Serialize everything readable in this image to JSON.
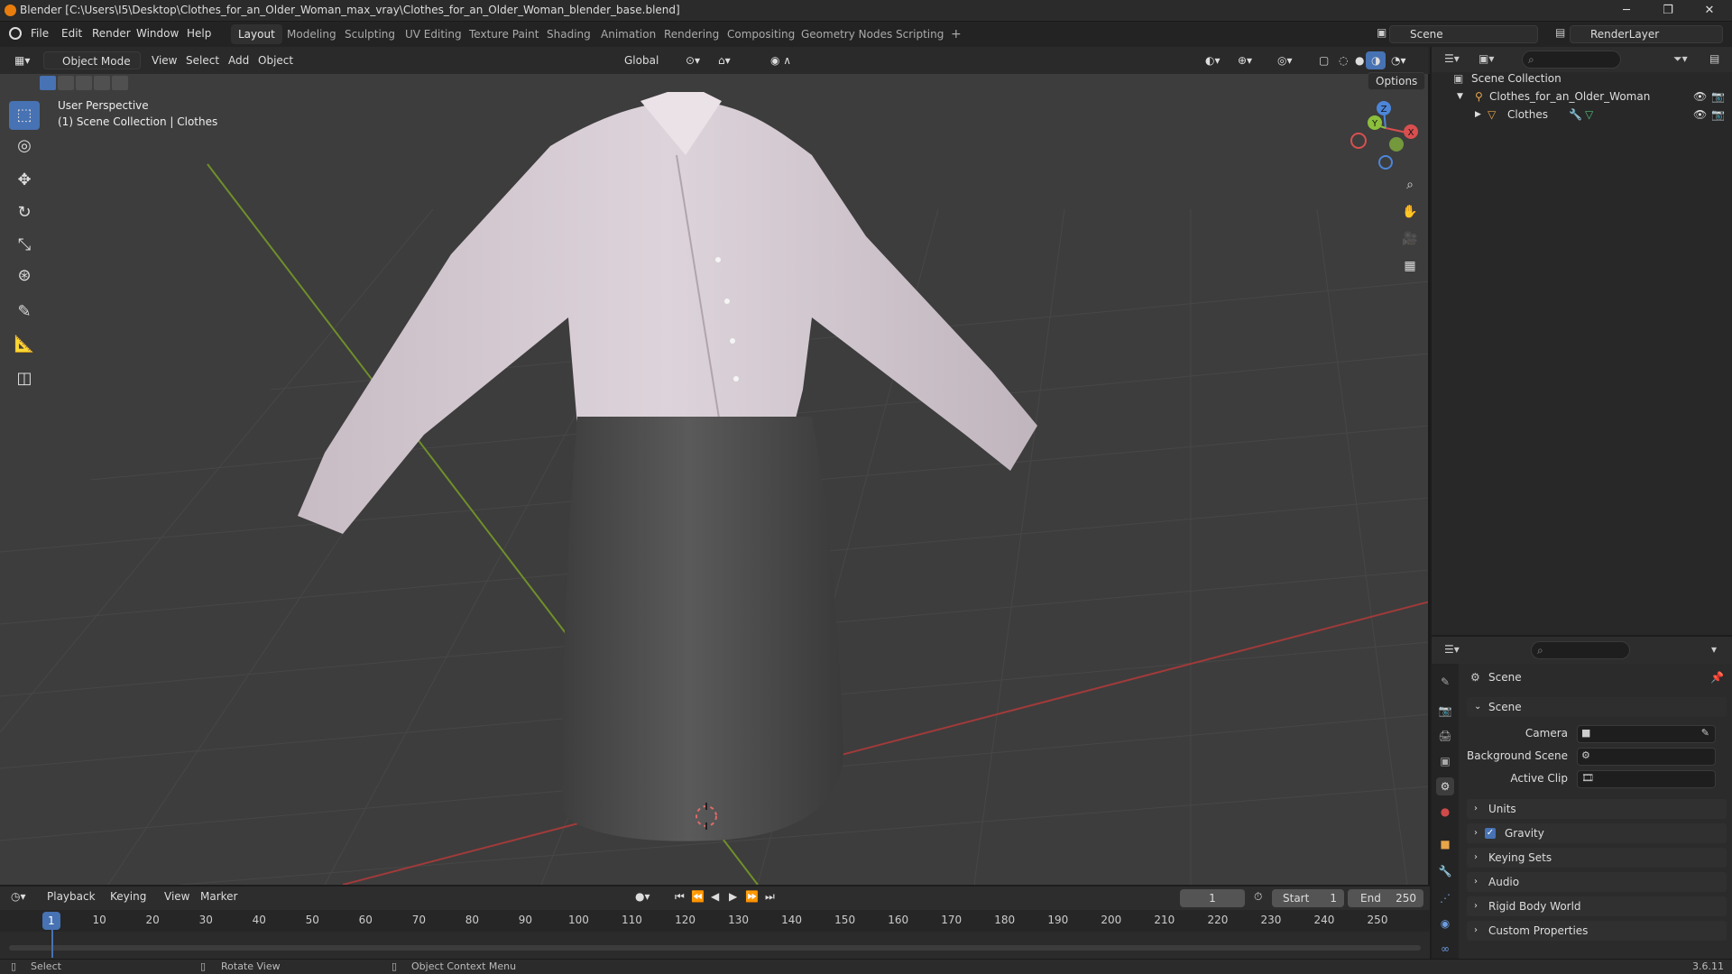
{
  "window": {
    "title": "Blender [C:\\Users\\I5\\Desktop\\Clothes_for_an_Older_Woman_max_vray\\Clothes_for_an_Older_Woman_blender_base.blend]"
  },
  "menu": [
    "File",
    "Edit",
    "Render",
    "Window",
    "Help"
  ],
  "workspaces": [
    "Layout",
    "Modeling",
    "Sculpting",
    "UV Editing",
    "Texture Paint",
    "Shading",
    "Animation",
    "Rendering",
    "Compositing",
    "Geometry Nodes",
    "Scripting"
  ],
  "active_workspace": "Layout",
  "scene_field": "Scene",
  "render_layer_field": "RenderLayer",
  "viewport": {
    "mode": "Object Mode",
    "menus": [
      "View",
      "Select",
      "Add",
      "Object"
    ],
    "transform_orientation": "Global",
    "options_label": "Options",
    "overlay_line1": "User Perspective",
    "overlay_line2": "(1) Scene Collection | Clothes",
    "gizmo_axes": {
      "x": "X",
      "y": "Y",
      "z": "Z"
    }
  },
  "timeline": {
    "menus": [
      "Playback",
      "Keying",
      "View",
      "Marker"
    ],
    "current_frame": "1",
    "start_label": "Start",
    "start_value": "1",
    "end_label": "End",
    "end_value": "250",
    "ticks": [
      "1",
      "10",
      "20",
      "30",
      "40",
      "50",
      "60",
      "70",
      "80",
      "90",
      "100",
      "110",
      "120",
      "130",
      "140",
      "150",
      "160",
      "170",
      "180",
      "190",
      "200",
      "210",
      "220",
      "230",
      "240",
      "250"
    ]
  },
  "status": {
    "select": "Select",
    "rotate": "Rotate View",
    "context_menu": "Object Context Menu",
    "version": "3.6.11"
  },
  "outliner": {
    "root": "Scene Collection",
    "collection": "Clothes_for_an_Older_Woman",
    "object": "Clothes"
  },
  "properties": {
    "context": "Scene",
    "panel_scene": "Scene",
    "camera_label": "Camera",
    "background_scene_label": "Background Scene",
    "active_clip_label": "Active Clip",
    "panels": [
      "Units",
      "Gravity",
      "Keying Sets",
      "Audio",
      "Rigid Body World",
      "Custom Properties"
    ],
    "gravity_checked": true
  },
  "colors": {
    "accent": "#4772b3",
    "x_axis": "#d94f4f",
    "y_axis": "#8bbf3c",
    "z_axis": "#4d86d9"
  }
}
